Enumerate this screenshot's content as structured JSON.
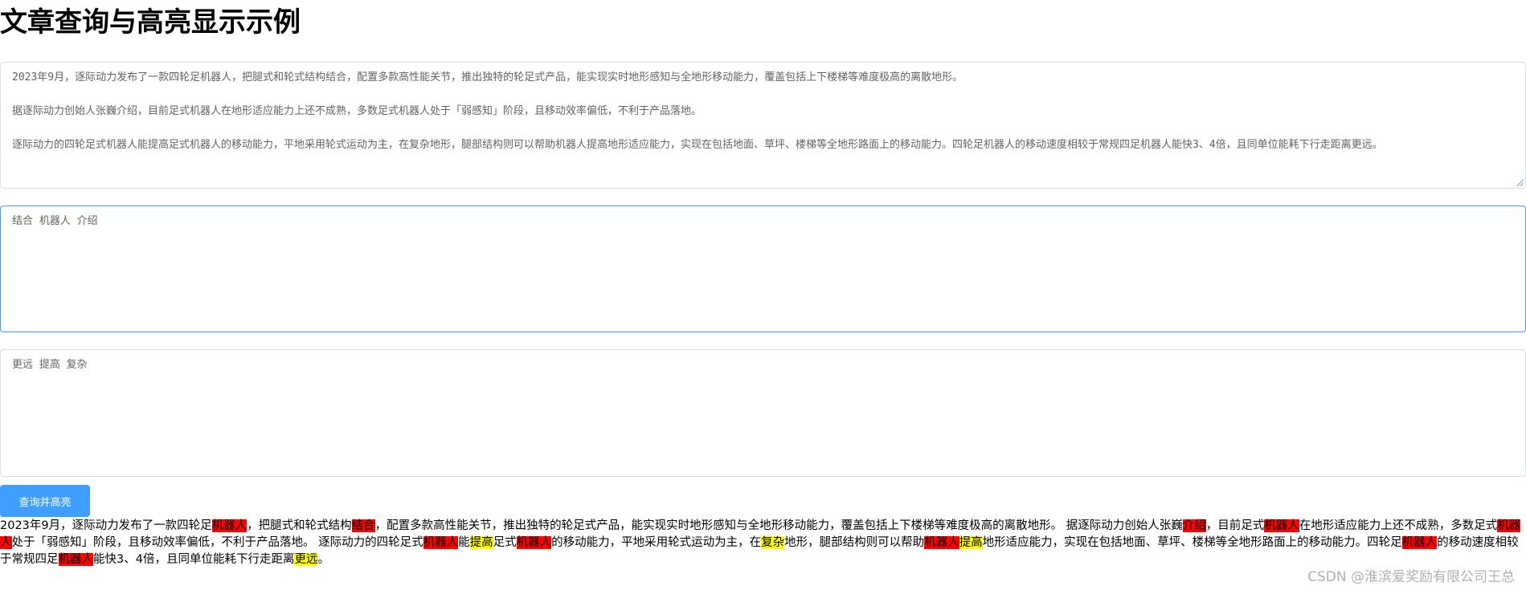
{
  "page": {
    "title": "文章查询与高亮显示示例",
    "watermark": "CSDN @淮滨爱奖励有限公司王总"
  },
  "article_input": {
    "value": "2023年9月，逐际动力发布了一款四轮足机器人，把腿式和轮式结构结合，配置多款高性能关节，推出独特的轮足式产品，能实现实时地形感知与全地形移动能力，覆盖包括上下楼梯等难度极高的离散地形。\n\n据逐际动力创始人张巍介绍，目前足式机器人在地形适应能力上还不成熟，多数足式机器人处于「弱感知」阶段，且移动效率偏低，不利于产品落地。\n\n逐际动力的四轮足式机器人能提高足式机器人的移动能力，平地采用轮式运动为主，在复杂地形，腿部结构则可以帮助机器人提高地形适应能力，实现在包括地面、草坪、楼梯等全地形路面上的移动能力。四轮足机器人的移动速度相较于常规四足机器人能快3、4倍，且同单位能耗下行走距离更远。"
  },
  "red_keywords_input": {
    "value": "结合 机器人 介绍"
  },
  "yellow_keywords_input": {
    "value": "更远 提高 复杂"
  },
  "query_button": {
    "label": "查询并高亮"
  },
  "colors": {
    "primary": "#409eff",
    "highlight_red": "#ff0000",
    "highlight_yellow": "#ffff00",
    "border": "#dcdfe6"
  },
  "result": {
    "segments": [
      {
        "text": "2023年9月，逐际动力发布了一款四轮足",
        "hl": ""
      },
      {
        "text": "机器人",
        "hl": "red"
      },
      {
        "text": "，把腿式和轮式结构",
        "hl": ""
      },
      {
        "text": "结合",
        "hl": "red"
      },
      {
        "text": "，配置多款高性能关节，推出独特的轮足式产品，能实现实时地形感知与全地形移动能力，覆盖包括上下楼梯等难度极高的离散地形。 据逐际动力创始人张巍",
        "hl": ""
      },
      {
        "text": "介绍",
        "hl": "red"
      },
      {
        "text": "，目前足式",
        "hl": ""
      },
      {
        "text": "机器人",
        "hl": "red"
      },
      {
        "text": "在地形适应能力上还不成熟，多数足式",
        "hl": ""
      },
      {
        "text": "机器人",
        "hl": "red"
      },
      {
        "text": "处于「弱感知」阶段，且移动效率偏低，不利于产品落地。 逐际动力的四轮足式",
        "hl": ""
      },
      {
        "text": "机器人",
        "hl": "red"
      },
      {
        "text": "能",
        "hl": ""
      },
      {
        "text": "提高",
        "hl": "yellow"
      },
      {
        "text": "足式",
        "hl": ""
      },
      {
        "text": "机器人",
        "hl": "red"
      },
      {
        "text": "的移动能力，平地采用轮式运动为主，在",
        "hl": ""
      },
      {
        "text": "复杂",
        "hl": "yellow"
      },
      {
        "text": "地形，腿部结构则可以帮助",
        "hl": ""
      },
      {
        "text": "机器人",
        "hl": "red"
      },
      {
        "text": "提高",
        "hl": "yellow"
      },
      {
        "text": "地形适应能力，实现在包括地面、草坪、楼梯等全地形路面上的移动能力。四轮足",
        "hl": ""
      },
      {
        "text": "机器人",
        "hl": "red"
      },
      {
        "text": "的移动速度相较于常规四足",
        "hl": ""
      },
      {
        "text": "机器人",
        "hl": "red"
      },
      {
        "text": "能快3、4倍，且同单位能耗下行走距离",
        "hl": ""
      },
      {
        "text": "更远",
        "hl": "yellow"
      },
      {
        "text": "。",
        "hl": ""
      }
    ]
  }
}
